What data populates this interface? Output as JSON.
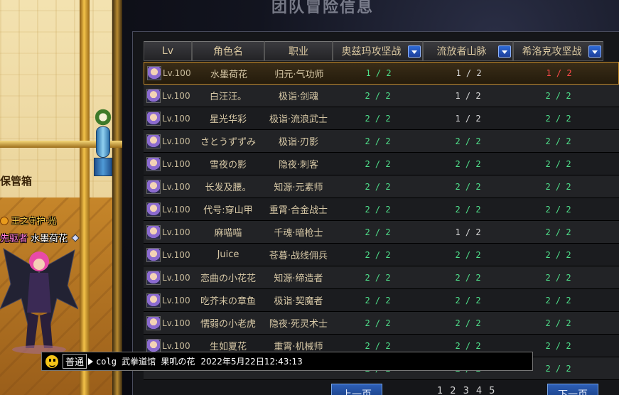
{
  "scene": {
    "storage_label": "保管箱",
    "guild_title": "王之守护·光",
    "player_title": "先驱者",
    "player_name": "水墨荷花"
  },
  "panel": {
    "title": "团队冒险信息"
  },
  "table": {
    "columns": [
      {
        "label": "Lv",
        "dropdown": false
      },
      {
        "label": "角色名",
        "dropdown": false
      },
      {
        "label": "职业",
        "dropdown": false
      },
      {
        "label": "奥兹玛攻坚战",
        "dropdown": true
      },
      {
        "label": "流放者山脉",
        "dropdown": true
      },
      {
        "label": "希洛克攻坚战",
        "dropdown": true
      }
    ],
    "rows": [
      {
        "lv": "Lv.100",
        "name": "水墨荷花",
        "job": "归元·气功师",
        "c1": "1 / 2",
        "c2": "1 / 2",
        "c3": "1 / 2",
        "s1": "green",
        "s2": "white",
        "s3": "red",
        "selected": true
      },
      {
        "lv": "Lv.100",
        "name": "白汪汪。",
        "job": "极诣·剑魂",
        "c1": "2 / 2",
        "c2": "1 / 2",
        "c3": "2 / 2",
        "s1": "green",
        "s2": "white",
        "s3": "green",
        "selected": false
      },
      {
        "lv": "Lv.100",
        "name": "星光华彩",
        "job": "极诣·流浪武士",
        "c1": "2 / 2",
        "c2": "1 / 2",
        "c3": "2 / 2",
        "s1": "green",
        "s2": "white",
        "s3": "green",
        "selected": false
      },
      {
        "lv": "Lv.100",
        "name": "さとうずずみ",
        "job": "极诣·刃影",
        "c1": "2 / 2",
        "c2": "2 / 2",
        "c3": "2 / 2",
        "s1": "green",
        "s2": "green",
        "s3": "green",
        "selected": false
      },
      {
        "lv": "Lv.100",
        "name": "雪夜の影",
        "job": "隐夜·刺客",
        "c1": "2 / 2",
        "c2": "2 / 2",
        "c3": "2 / 2",
        "s1": "green",
        "s2": "green",
        "s3": "green",
        "selected": false
      },
      {
        "lv": "Lv.100",
        "name": "长发及腰。",
        "job": "知源·元素师",
        "c1": "2 / 2",
        "c2": "2 / 2",
        "c3": "2 / 2",
        "s1": "green",
        "s2": "green",
        "s3": "green",
        "selected": false
      },
      {
        "lv": "Lv.100",
        "name": "代号:穿山甲",
        "job": "重霄·合金战士",
        "c1": "2 / 2",
        "c2": "2 / 2",
        "c3": "2 / 2",
        "s1": "green",
        "s2": "green",
        "s3": "green",
        "selected": false
      },
      {
        "lv": "Lv.100",
        "name": "麻喵喵",
        "job": "千魂·暗枪士",
        "c1": "2 / 2",
        "c2": "1 / 2",
        "c3": "2 / 2",
        "s1": "green",
        "s2": "white",
        "s3": "green",
        "selected": false
      },
      {
        "lv": "Lv.100",
        "name": "Juice",
        "job": "苍暮·战线佣兵",
        "c1": "2 / 2",
        "c2": "2 / 2",
        "c3": "2 / 2",
        "s1": "green",
        "s2": "green",
        "s3": "green",
        "selected": false
      },
      {
        "lv": "Lv.100",
        "name": "恋曲の小花花",
        "job": "知源·缔造者",
        "c1": "2 / 2",
        "c2": "2 / 2",
        "c3": "2 / 2",
        "s1": "green",
        "s2": "green",
        "s3": "green",
        "selected": false
      },
      {
        "lv": "Lv.100",
        "name": "吃芥末の章鱼",
        "job": "极诣·契魔者",
        "c1": "2 / 2",
        "c2": "2 / 2",
        "c3": "2 / 2",
        "s1": "green",
        "s2": "green",
        "s3": "green",
        "selected": false
      },
      {
        "lv": "Lv.100",
        "name": "懦弱の小老虎",
        "job": "隐夜·死灵术士",
        "c1": "2 / 2",
        "c2": "2 / 2",
        "c3": "2 / 2",
        "s1": "green",
        "s2": "green",
        "s3": "green",
        "selected": false
      },
      {
        "lv": "Lv.100",
        "name": "生如夏花",
        "job": "重霄·机械师",
        "c1": "2 / 2",
        "c2": "2 / 2",
        "c3": "2 / 2",
        "s1": "green",
        "s2": "green",
        "s3": "green",
        "selected": false
      },
      {
        "lv": "",
        "name": "",
        "job": "",
        "c1": "2 / 2",
        "c2": "2 / 2",
        "c3": "2 / 2",
        "s1": "green",
        "s2": "green",
        "s3": "green",
        "selected": false
      }
    ]
  },
  "chat": {
    "channel": "普通",
    "message": "colg 武拳道馆 果叽の花",
    "timestamp": "2022年5月22日12:43:13"
  },
  "pagination": {
    "prev_label": "上一页",
    "next_label": "下一页",
    "pages": [
      "1",
      "2",
      "3",
      "4",
      "5"
    ]
  }
}
